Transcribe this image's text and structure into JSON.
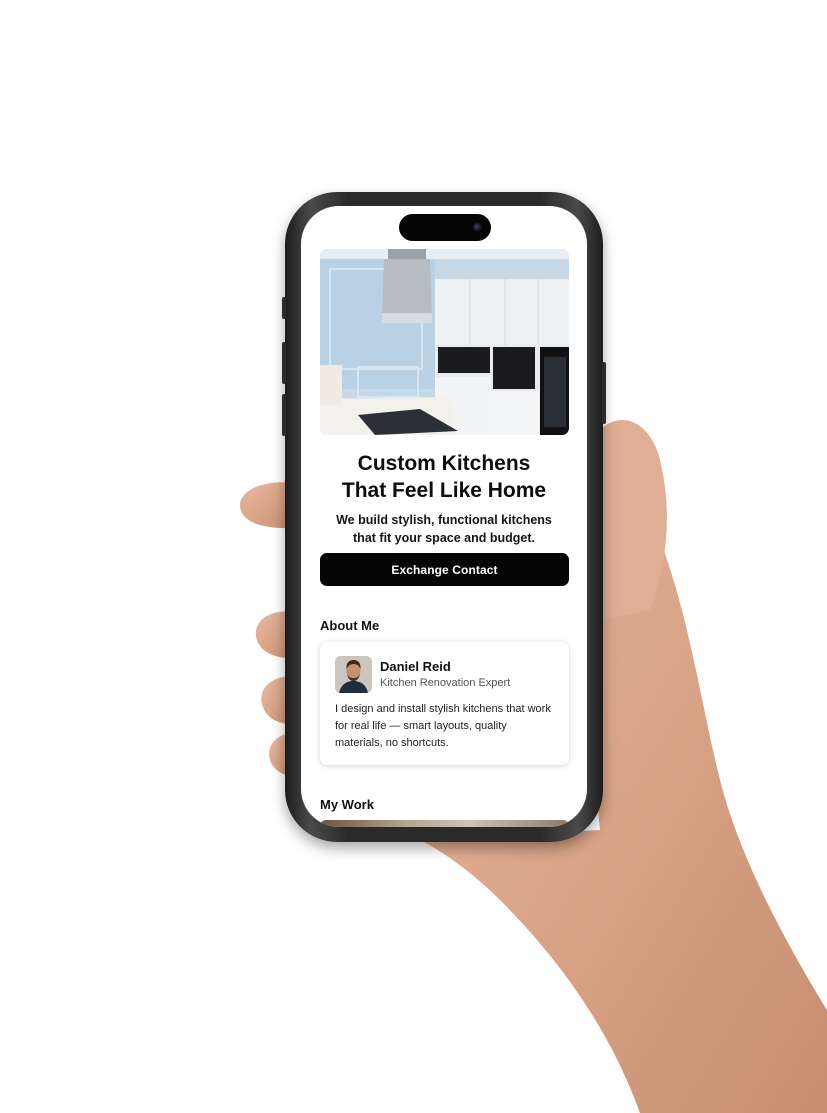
{
  "hero": {
    "image_alt": "Modern light-blue kitchen with stainless range hood, white cabinets and built-in ovens"
  },
  "headline": "Custom Kitchens\nThat Feel Like Home",
  "subheadline": "We build stylish, functional kitchens\nthat fit your space and budget.",
  "cta_label": "Exchange Contact",
  "about": {
    "heading": "About Me",
    "name": "Daniel Reid",
    "role": "Kitchen Renovation Expert",
    "bio": "I design and install stylish kitchens that work for real life — smart layouts, quality materials, no shortcuts."
  },
  "work": {
    "heading": "My Work"
  },
  "colors": {
    "cta_background": "#050505",
    "cta_text": "#ffffff",
    "phone_frame": "#2a2a2a",
    "accent_kitchen_blue": "#bcd3e4"
  }
}
